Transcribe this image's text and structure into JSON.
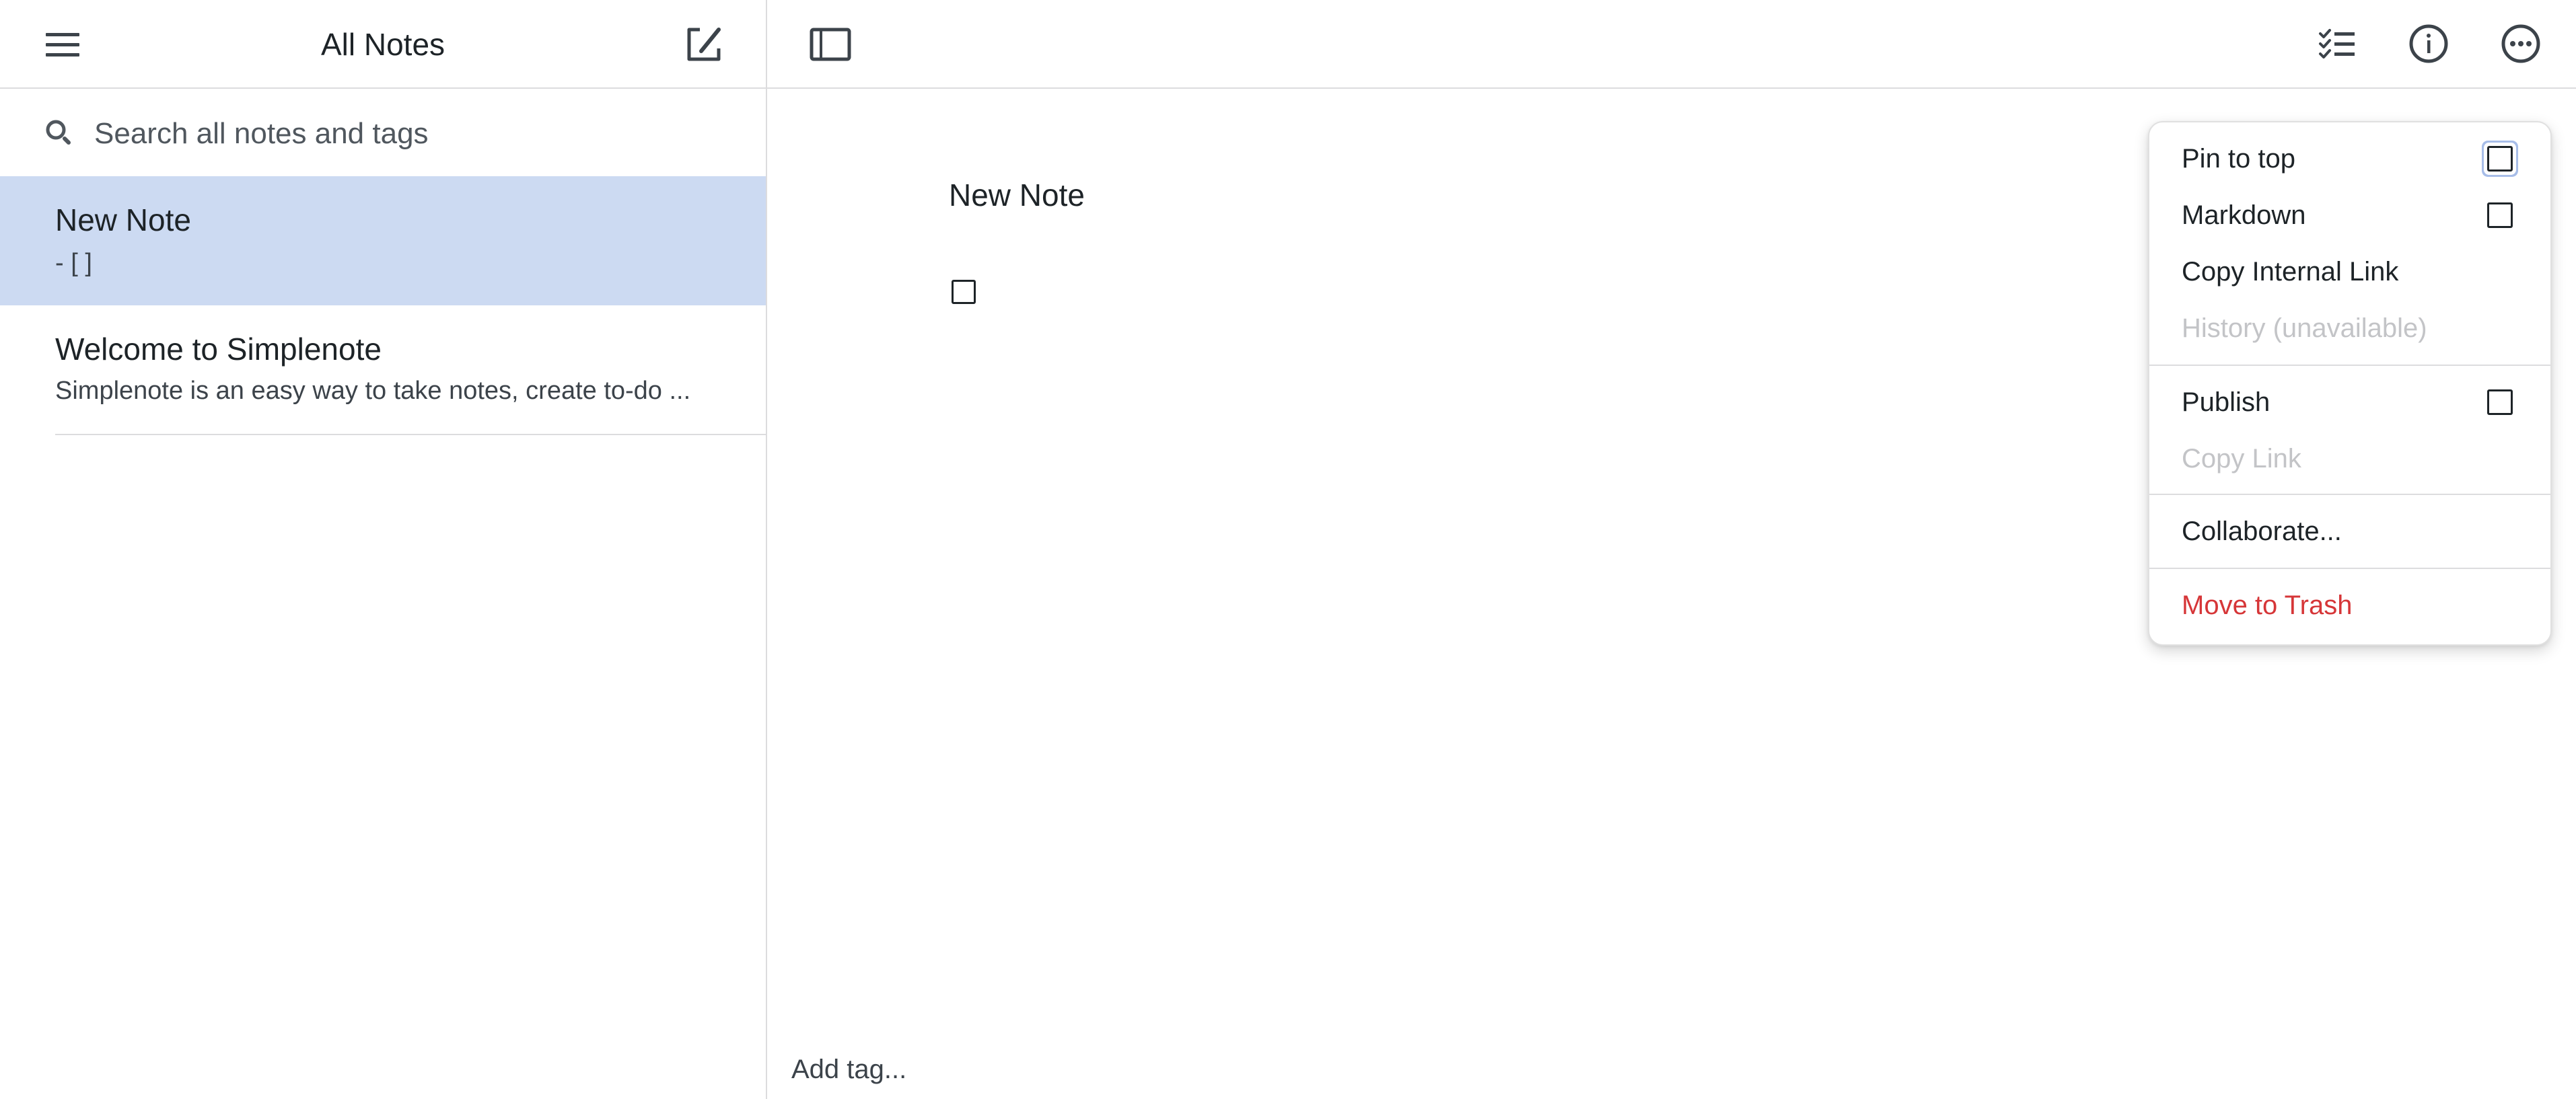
{
  "list": {
    "title": "All Notes",
    "menu_icon": "hamburger-menu-icon",
    "new_note_icon": "new-note-icon",
    "search": {
      "placeholder": "Search all notes and tags",
      "value": "",
      "icon": "search-icon"
    },
    "notes": [
      {
        "title": "New Note",
        "preview": "- [ ]",
        "selected": true
      },
      {
        "title": "Welcome to Simplenote",
        "preview": "Simplenote is an easy way to take notes, create to-do ...",
        "selected": false
      }
    ]
  },
  "toolbar": {
    "sidebar_toggle_icon": "sidebar-toggle-icon",
    "checklist_icon": "checklist-icon",
    "info_icon": "info-icon",
    "more_icon": "more-options-icon"
  },
  "editor": {
    "title": "New Note",
    "checklist_item_checked": false,
    "tag_input": {
      "placeholder": "Add tag...",
      "value": ""
    }
  },
  "actions_menu": {
    "items": [
      {
        "label": "Pin to top",
        "type": "checkbox",
        "checked": false,
        "enabled": true,
        "focused": true
      },
      {
        "label": "Markdown",
        "type": "checkbox",
        "checked": false,
        "enabled": true
      },
      {
        "label": "Copy Internal Link",
        "type": "action",
        "enabled": true
      },
      {
        "label": "History (unavailable)",
        "type": "action",
        "enabled": false
      },
      {
        "label": "Publish",
        "type": "checkbox",
        "checked": false,
        "enabled": true
      },
      {
        "label": "Copy Link",
        "type": "action",
        "enabled": false
      },
      {
        "label": "Collaborate...",
        "type": "action",
        "enabled": true
      },
      {
        "label": "Move to Trash",
        "type": "action",
        "enabled": true,
        "danger": true
      }
    ]
  },
  "colors": {
    "selected_note_bg": "#ccdaf2",
    "danger": "#d63638",
    "disabled_text": "#c3c4c7",
    "divider": "#dcdcde",
    "focus_ring": "#a7bde8"
  }
}
